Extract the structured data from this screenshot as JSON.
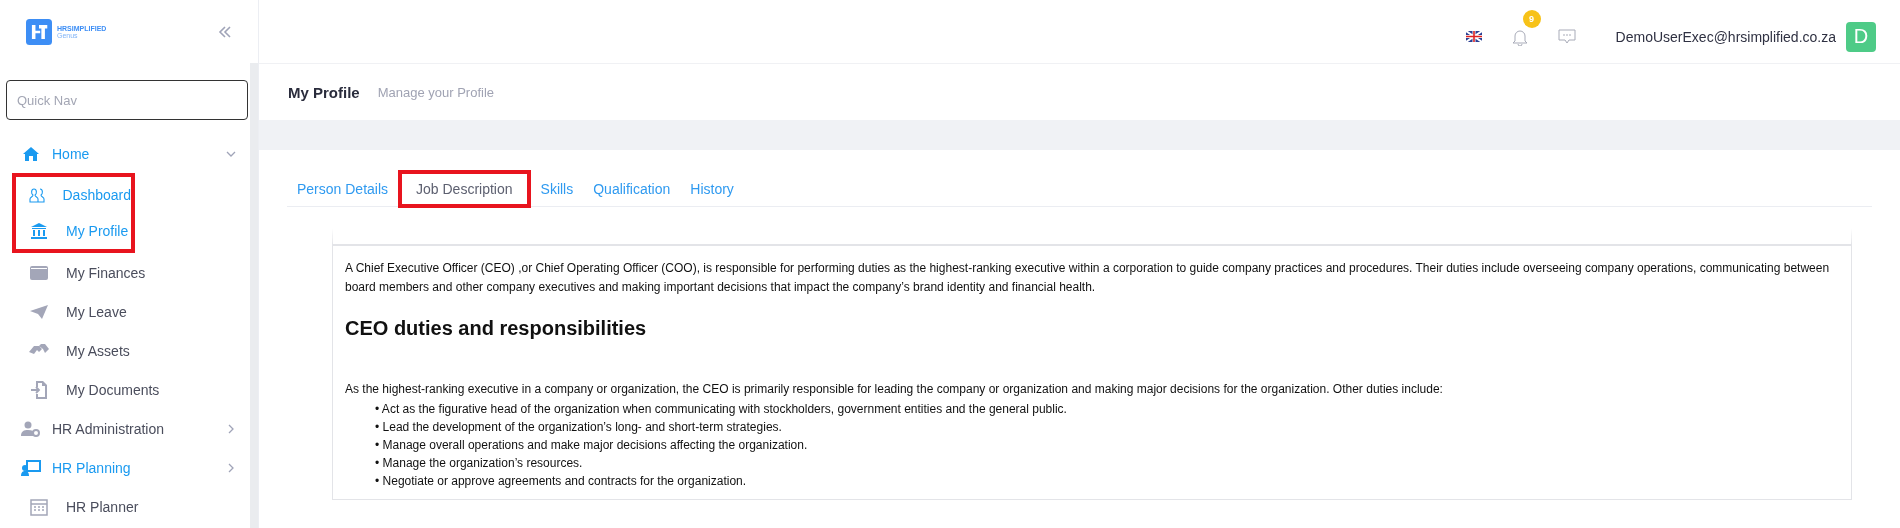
{
  "brand": {
    "name": "HRSIMPLIFIED",
    "subtitle": "Genus"
  },
  "quick_nav": {
    "placeholder": "Quick Nav"
  },
  "sidebar": {
    "items": [
      {
        "label": "Home",
        "active": true,
        "expanded": true,
        "children": [
          {
            "label": "Dashboard",
            "active": true,
            "highlighted": true
          },
          {
            "label": "My Profile",
            "active": true,
            "highlighted": true
          },
          {
            "label": "My Finances",
            "active": false,
            "highlighted": false
          },
          {
            "label": "My Leave",
            "active": false,
            "highlighted": false
          },
          {
            "label": "My Assets",
            "active": false,
            "highlighted": false
          },
          {
            "label": "My Documents",
            "active": false,
            "highlighted": false
          }
        ]
      },
      {
        "label": "HR Administration",
        "active": false,
        "expanded": false
      },
      {
        "label": "HR Planning",
        "active": true,
        "expanded": false,
        "children": [
          {
            "label": "HR Planner",
            "active": false,
            "highlighted": false
          }
        ]
      }
    ]
  },
  "topbar": {
    "notifications": "9",
    "user": "DemoUserExec@hrsimplified.co.za",
    "avatar": "D"
  },
  "page": {
    "title": "My Profile",
    "subtitle": "Manage your Profile"
  },
  "tabs": [
    {
      "label": "Person Details",
      "selected": false,
      "highlighted": false
    },
    {
      "label": "Job Description",
      "selected": true,
      "highlighted": true
    },
    {
      "label": "Skills",
      "selected": false,
      "highlighted": false
    },
    {
      "label": "Qualification",
      "selected": false,
      "highlighted": false
    },
    {
      "label": "History",
      "selected": false,
      "highlighted": false
    }
  ],
  "job_description": {
    "intro": "A Chief Executive Officer (CEO) ,or Chief Operating Officer (COO), is responsible for performing duties as the highest-ranking executive within a corporation to guide company practices and procedures. Their duties include overseeing company operations, communicating between board members and other company executives and making important decisions that impact the company’s brand identity and financial health.",
    "heading": "CEO duties and responsibilities",
    "lead": "As the highest-ranking executive in a company or organization, the CEO is primarily responsible for leading the company or organization and making major decisions for the organization. Other duties include:",
    "bullets": [
      "• Act as the figurative head of the organization when communicating with stockholders, government entities and the general public.",
      "• Lead the development of the organization’s long- and short-term strategies.",
      "• Manage overall operations and make major decisions affecting the organization.",
      "• Manage the organization’s resources.",
      "• Negotiate or approve agreements and contracts for the organization."
    ]
  }
}
